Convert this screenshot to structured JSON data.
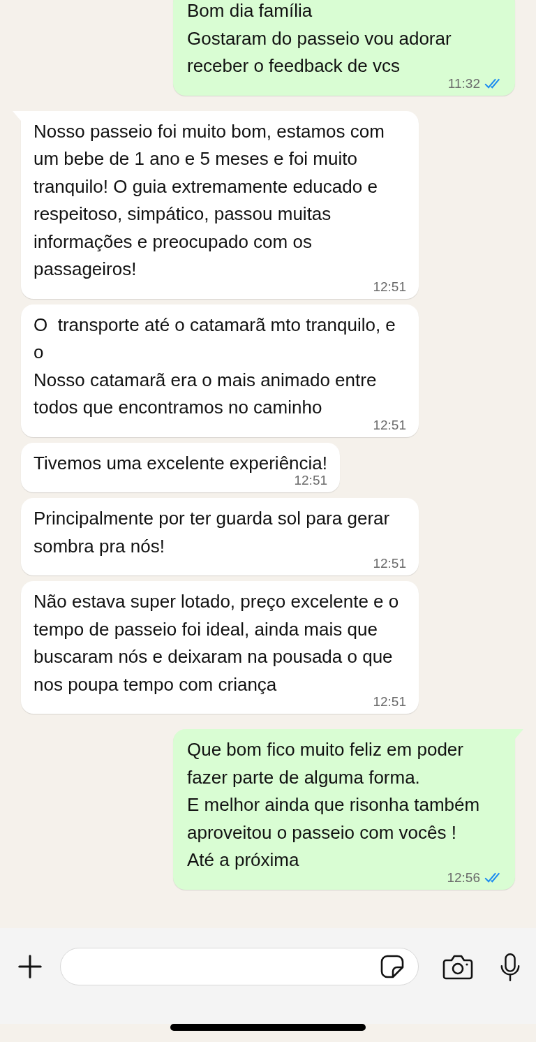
{
  "messages": [
    {
      "kind": "outgoing",
      "text": "Bom dia família\nGostaram do passeio vou adorar receber o feedback de vcs",
      "time": "11:32",
      "read": true,
      "tail": false
    },
    {
      "kind": "incoming",
      "text": "Nosso passeio foi muito bom, estamos com um bebe de 1 ano e 5 meses e foi muito tranquilo! O guia extremamente educado e respeitoso, simpático, passou muitas informações e preocupado com os passageiros!",
      "time": "12:51",
      "tail": true
    },
    {
      "kind": "incoming",
      "text": "O  transporte até o catamarã mto tranquilo, e o\nNosso catamarã era o mais animado entre todos que encontramos no caminho",
      "time": "12:51",
      "tail": false
    },
    {
      "kind": "incoming",
      "text": "Tivemos uma excelente experiência!",
      "time": "12:51",
      "tail": false
    },
    {
      "kind": "incoming",
      "text": "Principalmente por ter guarda sol para gerar sombra pra nós!",
      "time": "12:51",
      "tail": false
    },
    {
      "kind": "incoming",
      "text": "Não estava super lotado, preço excelente e o tempo de passeio foi ideal, ainda mais que buscaram nós e deixaram na pousada o que nos poupa tempo com criança",
      "time": "12:51",
      "tail": false
    },
    {
      "kind": "outgoing",
      "text": "Que bom fico muito feliz em poder fazer parte de alguma forma.\nE melhor ainda que risonha também aproveitou o passeio com vocês !\nAté a próxima",
      "time": "12:56",
      "read": true,
      "tail": true
    }
  ]
}
